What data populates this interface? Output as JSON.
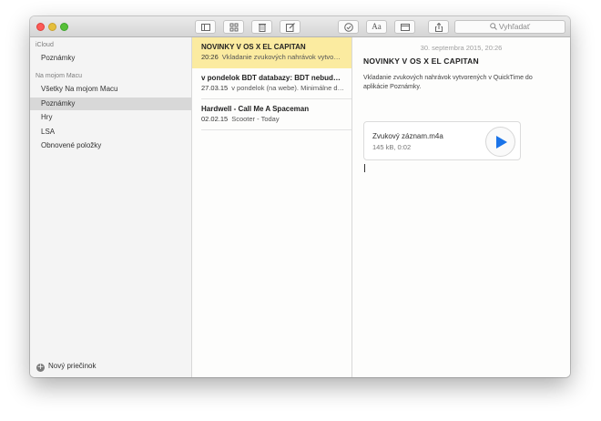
{
  "window": {
    "toolbar": {
      "icons": [
        "sidebar-toggle-icon",
        "attachments-grid-icon",
        "trash-icon",
        "compose-icon",
        "checklist-icon",
        "font-icon",
        "table-icon",
        "share-icon"
      ],
      "font_button_label": "Aa",
      "search_placeholder": "Vyhľadať"
    }
  },
  "sidebar": {
    "sections": [
      {
        "header": "iCloud",
        "items": [
          {
            "label": "Poznámky",
            "selected": false
          }
        ]
      },
      {
        "header": "Na mojom Macu",
        "items": [
          {
            "label": "Všetky Na mojom Macu",
            "selected": false
          },
          {
            "label": "Poznámky",
            "selected": true
          },
          {
            "label": "Hry",
            "selected": false
          },
          {
            "label": "LSA",
            "selected": false
          },
          {
            "label": "Obnovené položky",
            "selected": false
          }
        ]
      }
    ],
    "new_folder_label": "Nový priečinok"
  },
  "notes": [
    {
      "title": "NOVINKY V OS X EL CAPITAN",
      "time": "20:26",
      "preview": "Vkladanie zvukových nahrávok vytvo…",
      "selected": true
    },
    {
      "title": "v pondelok BDT databazy: BDT nebud…",
      "time": "27.03.15",
      "preview": "v pondelok (na webe). Minimálne d…",
      "selected": false
    },
    {
      "title": "Hardwell - Call Me A Spaceman",
      "time": "02.02.15",
      "preview": "Scooter - Today",
      "selected": false
    }
  ],
  "editor": {
    "date": "30. septembra 2015, 20:26",
    "title": "NOVINKY V OS X EL CAPITAN",
    "body": "Vkladanie zvukových nahrávok vytvorených v QuickTime do aplikácie Poznámky.",
    "attachment": {
      "filename": "Zvukový záznam.m4a",
      "info": "145 kB, 0:02",
      "play_icon": "play-icon",
      "accent_color": "#1a73e8"
    }
  },
  "colors": {
    "selected_note_bg": "#fbeba0",
    "selected_folder_bg": "#d8d8d8",
    "close": "#fc5b57",
    "minimize": "#e5bf3c",
    "maximize": "#57c038"
  }
}
